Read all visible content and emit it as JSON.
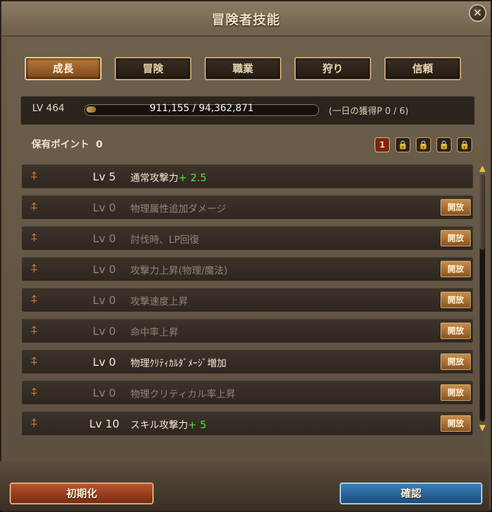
{
  "window": {
    "title": "冒険者技能",
    "close_label": "✕"
  },
  "tabs": [
    {
      "label": "成長",
      "active": true
    },
    {
      "label": "冒険",
      "active": false
    },
    {
      "label": "職業",
      "active": false
    },
    {
      "label": "狩り",
      "active": false
    },
    {
      "label": "信頼",
      "active": false
    }
  ],
  "level": {
    "label": "LV 464",
    "exp_text": "911,155 / 94,362,871",
    "exp_fraction": 0.0097,
    "daily_text": "(一日の獲得P 0 / 6)"
  },
  "points": {
    "label": "保有ポイント",
    "value": "0"
  },
  "pages": [
    {
      "label": "1",
      "active": true,
      "locked": false
    },
    {
      "label": "🔒",
      "active": false,
      "locked": true
    },
    {
      "label": "🔒",
      "active": false,
      "locked": true
    },
    {
      "label": "🔒",
      "active": false,
      "locked": true
    },
    {
      "label": "🔒",
      "active": false,
      "locked": true
    }
  ],
  "skills": [
    {
      "icon": "sword-icon",
      "level": "Lv 5",
      "name": "通常攻撃力",
      "bonus": "+ 2.5",
      "state": "on",
      "button": ""
    },
    {
      "icon": "sword-icon",
      "level": "Lv 0",
      "name": "物理属性追加ダメージ",
      "bonus": "",
      "state": "off",
      "button": "開放"
    },
    {
      "icon": "sword-icon",
      "level": "Lv 0",
      "name": "討伐時、LP回復",
      "bonus": "",
      "state": "off",
      "button": "開放"
    },
    {
      "icon": "sword-icon",
      "level": "Lv 0",
      "name": "攻撃力上昇(物理/魔法)",
      "bonus": "",
      "state": "off",
      "button": "開放"
    },
    {
      "icon": "sword-icon",
      "level": "Lv 0",
      "name": "攻撃速度上昇",
      "bonus": "",
      "state": "off",
      "button": "開放"
    },
    {
      "icon": "sword-icon",
      "level": "Lv 0",
      "name": "命中率上昇",
      "bonus": "",
      "state": "off",
      "button": "開放"
    },
    {
      "icon": "sword-icon",
      "level": "Lv 0",
      "name": "物理ｸﾘﾃｨｶﾙﾀﾞﾒｰｼﾞ増加",
      "bonus": "",
      "state": "on",
      "button": "開放"
    },
    {
      "icon": "sword-icon",
      "level": "Lv 0",
      "name": "物理クリティカル率上昇",
      "bonus": "",
      "state": "off",
      "button": "開放"
    },
    {
      "icon": "sword-icon",
      "level": "Lv 10",
      "name": "スキル攻撃力",
      "bonus": "+ 5",
      "state": "on",
      "button": "開放"
    }
  ],
  "footer": {
    "reset_label": "初期化",
    "confirm_label": "確認"
  }
}
